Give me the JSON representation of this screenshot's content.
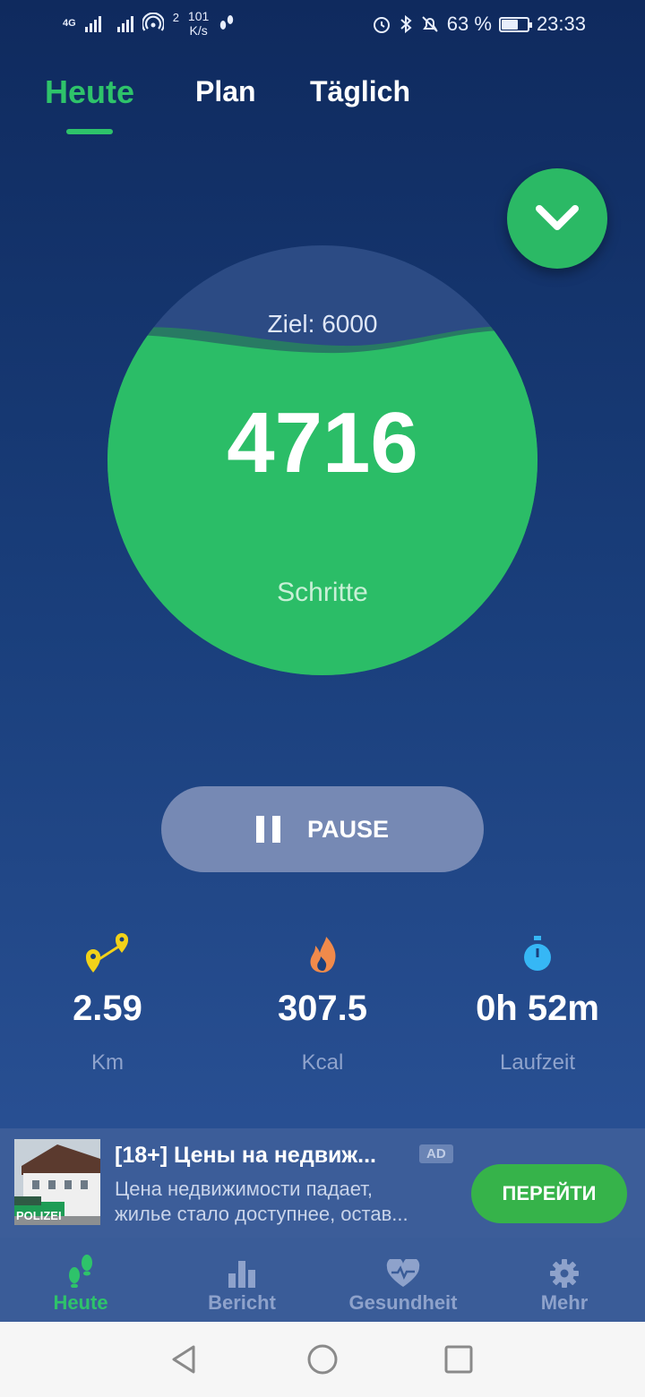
{
  "status_bar": {
    "network": "4G",
    "net_speed_top": "101",
    "net_speed_bottom": "K/s",
    "hotspot_count": "2",
    "battery": "63 %",
    "battery_level": 0.63,
    "time": "23:33"
  },
  "tabs": [
    {
      "label": "Heute",
      "active": true
    },
    {
      "label": "Plan",
      "active": false
    },
    {
      "label": "Täglich",
      "active": false
    }
  ],
  "goal": "Ziel: 6000",
  "steps": "4716",
  "steps_label": "Schritte",
  "progress": 0.786,
  "pause_label": "PAUSE",
  "stats": [
    {
      "icon": "map-pins-icon",
      "value": "2.59",
      "label": "Km"
    },
    {
      "icon": "flame-icon",
      "value": "307.5",
      "label": "Kcal"
    },
    {
      "icon": "stopwatch-icon",
      "value": "0h 52m",
      "label": "Laufzeit"
    }
  ],
  "ad": {
    "title": "[18+] Цены на недвиж...",
    "badge": "AD",
    "desc_line1": "Цена недвижимости падает,",
    "desc_line2": "жилье стало доступнее, остав...",
    "cta": "ПЕРЕЙТИ",
    "image_text": "POLIZEI"
  },
  "bottom_nav": [
    {
      "icon": "footsteps-icon",
      "label": "Heute",
      "active": true
    },
    {
      "icon": "bar-chart-icon",
      "label": "Bericht",
      "active": false
    },
    {
      "icon": "heart-pulse-icon",
      "label": "Gesundheit",
      "active": false
    },
    {
      "icon": "gear-icon",
      "label": "Mehr",
      "active": false
    }
  ],
  "colors": {
    "accent_green": "#2ec36a",
    "background_top": "#0f2a5e",
    "background_bottom": "#2c5598"
  }
}
